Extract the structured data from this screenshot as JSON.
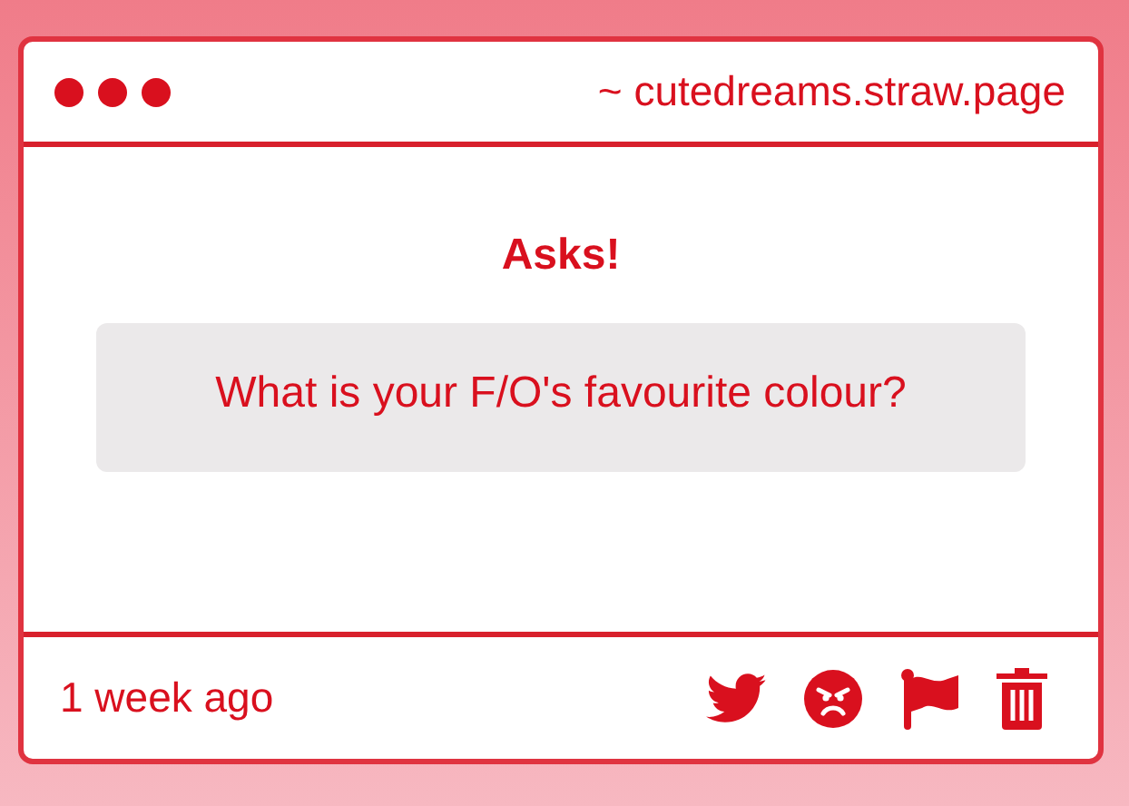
{
  "window": {
    "title": "~ cutedreams.straw.page"
  },
  "heading": "Asks!",
  "question": "What is your F/O's favourite colour?",
  "footer": {
    "time": "1 week ago"
  }
}
